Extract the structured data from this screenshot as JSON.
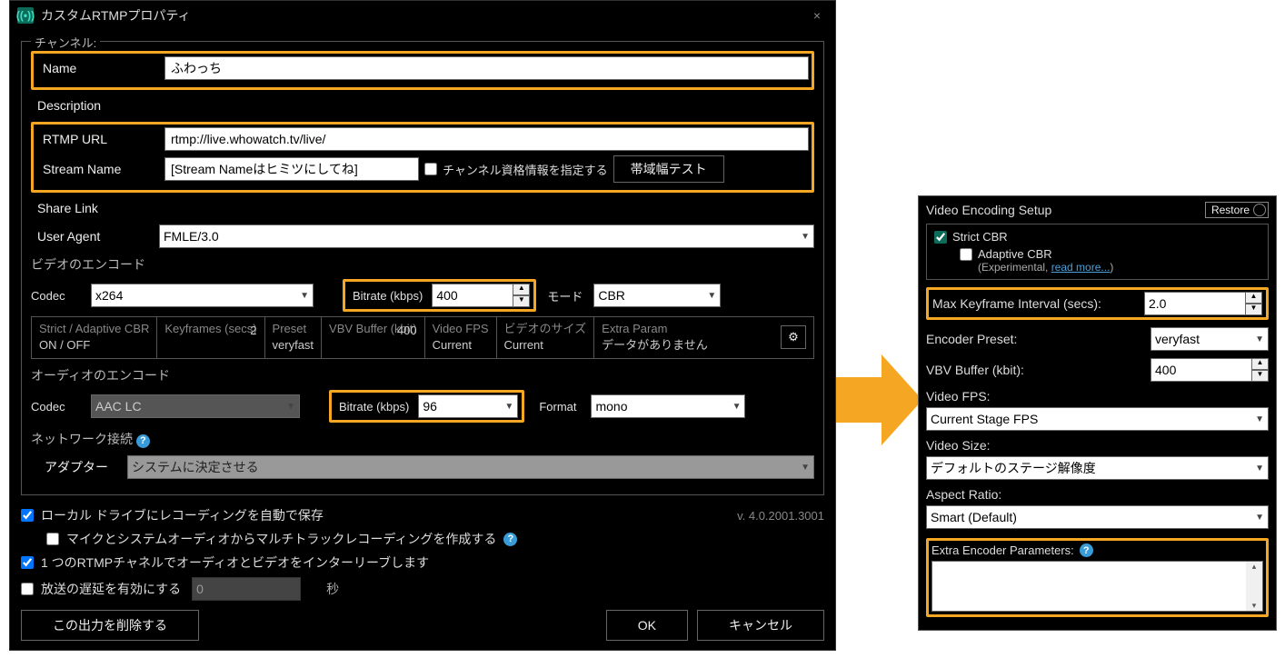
{
  "window": {
    "title": "カスタムRTMPプロパティ",
    "close_glyph": "×"
  },
  "channel": {
    "legend": "チャンネル:",
    "name_label": "Name",
    "name_value": "ふわっち",
    "desc_label": "Description",
    "url_label": "RTMP URL",
    "url_value": "rtmp://live.whowatch.tv/live/",
    "stream_label": "Stream Name",
    "stream_value": "[Stream Nameはヒミツにしてね]",
    "cred_checkbox": "チャンネル資格情報を指定する",
    "bandwidth_btn": "帯域幅テスト",
    "share_label": "Share Link",
    "ua_label": "User Agent",
    "ua_value": "FMLE/3.0"
  },
  "video": {
    "header": "ビデオのエンコード",
    "codec_label": "Codec",
    "codec_value": "x264",
    "bitrate_label": "Bitrate (kbps)",
    "bitrate_value": "400",
    "mode_label": "モード",
    "mode_value": "CBR",
    "info": {
      "strict_label": "Strict / Adaptive CBR",
      "strict_value": "ON / OFF",
      "keyframes_label": "Keyframes (secs)",
      "keyframes_value": "2",
      "preset_label": "Preset",
      "preset_value": "veryfast",
      "vbv_label": "VBV Buffer (kbit)",
      "vbv_value": "400",
      "fps_label": "Video FPS",
      "fps_value": "Current",
      "size_label": "ビデオのサイズ",
      "size_value": "Current",
      "extra_label": "Extra Param",
      "extra_value": "データがありません"
    }
  },
  "audio": {
    "header": "オーディオのエンコード",
    "codec_label": "Codec",
    "codec_value": "AAC LC",
    "bitrate_label": "Bitrate (kbps)",
    "bitrate_value": "96",
    "format_label": "Format",
    "format_value": "mono"
  },
  "network": {
    "header": "ネットワーク接続",
    "adapter_label": "アダプター",
    "adapter_value": "システムに決定させる"
  },
  "footer": {
    "auto_save": "ローカル ドライブにレコーディングを自動で保存",
    "multitrack": "マイクとシステムオーディオからマルチトラックレコーディングを作成する",
    "interleave": "1 つのRTMPチャネルでオーディオとビデオをインターリーブします",
    "delay_label": "放送の遅延を有効にする",
    "delay_value": "0",
    "delay_unit": "秒",
    "version": "v. 4.0.2001.3001",
    "delete_btn": "この出力を削除する",
    "ok_btn": "OK",
    "cancel_btn": "キャンセル"
  },
  "panel2": {
    "title": "Video Encoding Setup",
    "restore_btn": "Restore",
    "strict_cbr": "Strict CBR",
    "adaptive_cbr": "Adaptive CBR",
    "adaptive_note1": "(Experimental, ",
    "adaptive_note2": "read more...",
    "adaptive_note3": ")",
    "keyframe_label": "Max Keyframe Interval (secs):",
    "keyframe_value": "2.0",
    "preset_label": "Encoder Preset:",
    "preset_value": "veryfast",
    "vbv_label": "VBV Buffer (kbit):",
    "vbv_value": "400",
    "fps_label": "Video FPS:",
    "fps_value": "Current Stage FPS",
    "size_label": "Video Size:",
    "size_value": "デフォルトのステージ解像度",
    "aspect_label": "Aspect Ratio:",
    "aspect_value": "Smart (Default)",
    "extra_label": "Extra Encoder Parameters:",
    "extra_value": ""
  }
}
